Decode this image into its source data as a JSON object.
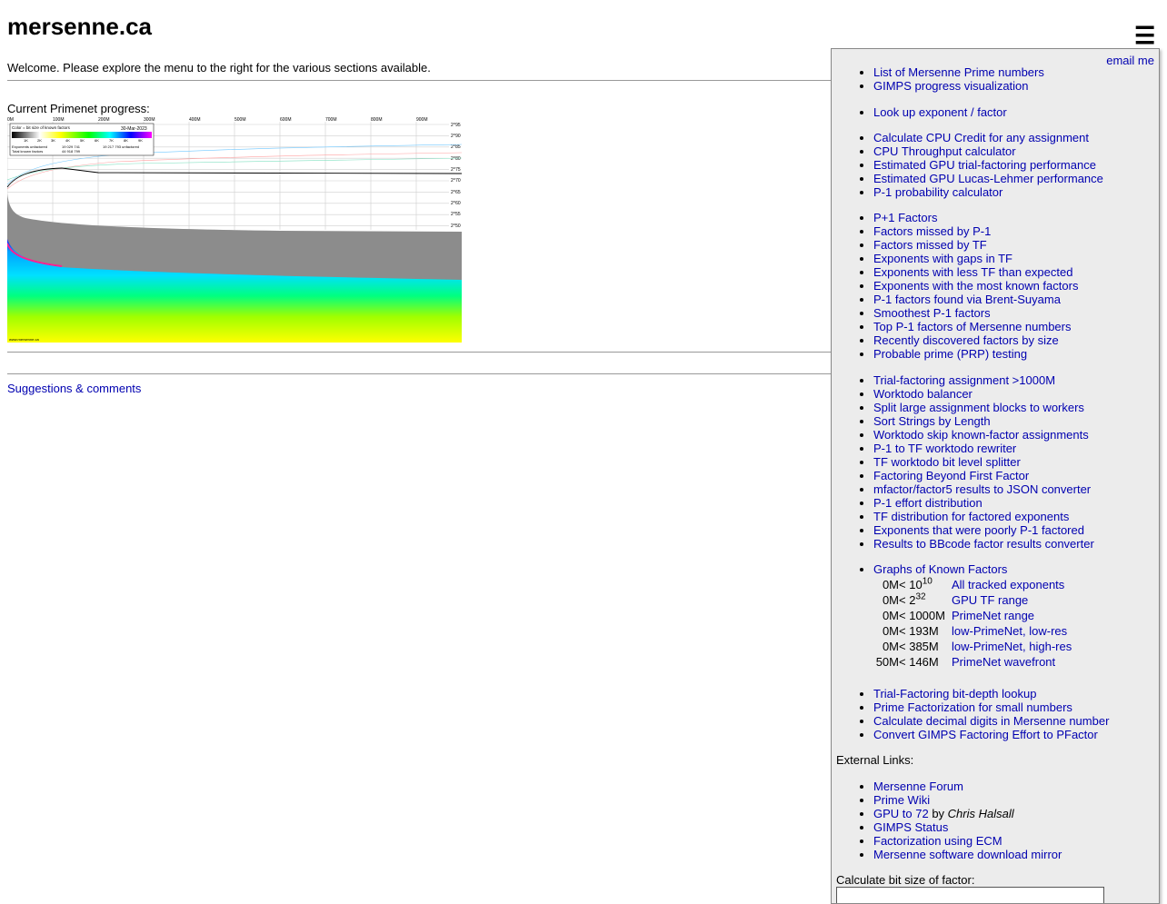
{
  "site": {
    "title": "mersenne.ca",
    "welcome": "Welcome. Please explore the menu to the right for the various sections available.",
    "progress_label": "Current Primenet progress:",
    "suggestions_link": "Suggestions & comments"
  },
  "chart": {
    "x_ticks": [
      "0M",
      "100M",
      "200M",
      "300M",
      "400M",
      "500M",
      "600M",
      "700M",
      "800M",
      "900M"
    ],
    "y_ticks": [
      "2^95",
      "2^90",
      "2^85",
      "2^80",
      "2^75",
      "2^70",
      "2^65",
      "2^60",
      "2^55",
      "2^50"
    ],
    "legend_title": "Color = bit size of known factors",
    "legend_date": "30-Mar-2023",
    "legend_scale": [
      "1K",
      "2K",
      "3K",
      "4K",
      "5K",
      "6K",
      "7K",
      "8K",
      "9K"
    ],
    "legend_row1_label": "Exponents unfactored",
    "legend_row1_value": "19 029 741",
    "legend_row1_right": "19 217 793 unfactored",
    "legend_row2_label": "Total known factors",
    "legend_row2_value": "44 918 799",
    "watermark": "www.mersenne.ca"
  },
  "menu": {
    "email_label": "email me",
    "hamburger_icon": "hamburger-menu-icon",
    "group1": [
      "List of Mersenne Prime numbers",
      "GIMPS progress visualization"
    ],
    "group2": [
      "Look up exponent / factor"
    ],
    "group3": [
      "Calculate CPU Credit for any assignment",
      "CPU Throughput calculator",
      "Estimated GPU trial-factoring performance",
      "Estimated GPU Lucas-Lehmer performance",
      "P-1 probability calculator"
    ],
    "group4": [
      "P+1 Factors",
      "Factors missed by P-1",
      "Factors missed by TF",
      "Exponents with gaps in TF",
      "Exponents with less TF than expected",
      "Exponents with the most known factors",
      "P-1 factors found via Brent-Suyama",
      "Smoothest P-1 factors",
      "Top P-1 factors of Mersenne numbers",
      "Recently discovered factors by size",
      "Probable prime (PRP) testing"
    ],
    "group5": [
      "Trial-factoring assignment >1000M",
      "Worktodo balancer",
      "Split large assignment blocks to workers",
      "Sort Strings by Length",
      "Worktodo skip known-factor assignments",
      "P-1 to TF worktodo rewriter",
      "TF worktodo bit level splitter",
      "Factoring Beyond First Factor",
      "mfactor/factor5 results to JSON converter",
      "P-1 effort distribution",
      "TF distribution for factored exponents",
      "Exponents that were poorly P-1 factored",
      "Results to BBcode factor results converter"
    ],
    "graphs_heading": "Graphs of Known Factors",
    "graph_rows": [
      {
        "from": "0M",
        "lt": "<",
        "base": "10",
        "exp": "10",
        "link": "All tracked exponents"
      },
      {
        "from": "0M",
        "lt": "<",
        "base": "2",
        "exp": "32",
        "link": "GPU TF range"
      },
      {
        "from": "0M",
        "lt": "<",
        "base": "1000M",
        "exp": "",
        "link": "PrimeNet range"
      },
      {
        "from": "0M",
        "lt": "<",
        "base": "193M",
        "exp": "",
        "link": "low-PrimeNet, low-res"
      },
      {
        "from": "0M",
        "lt": "<",
        "base": "385M",
        "exp": "",
        "link": "low-PrimeNet, high-res"
      },
      {
        "from": "50M",
        "lt": "<",
        "base": "146M",
        "exp": "",
        "link": "PrimeNet wavefront"
      }
    ],
    "group6": [
      "Trial-Factoring bit-depth lookup",
      "Prime Factorization for small numbers",
      "Calculate decimal digits in Mersenne number",
      "Convert GIMPS Factoring Effort to PFactor"
    ],
    "external_label": "External Links:",
    "external": [
      "Mersenne Forum",
      "Prime Wiki"
    ],
    "gpu72": {
      "link": "GPU to 72",
      "by": " by ",
      "author": "Chris Halsall"
    },
    "external2": [
      "GIMPS Status",
      "Factorization using ECM",
      "Mersenne software download mirror"
    ],
    "bitsize_label": "Calculate bit size of factor:",
    "bitsize_value": ""
  }
}
